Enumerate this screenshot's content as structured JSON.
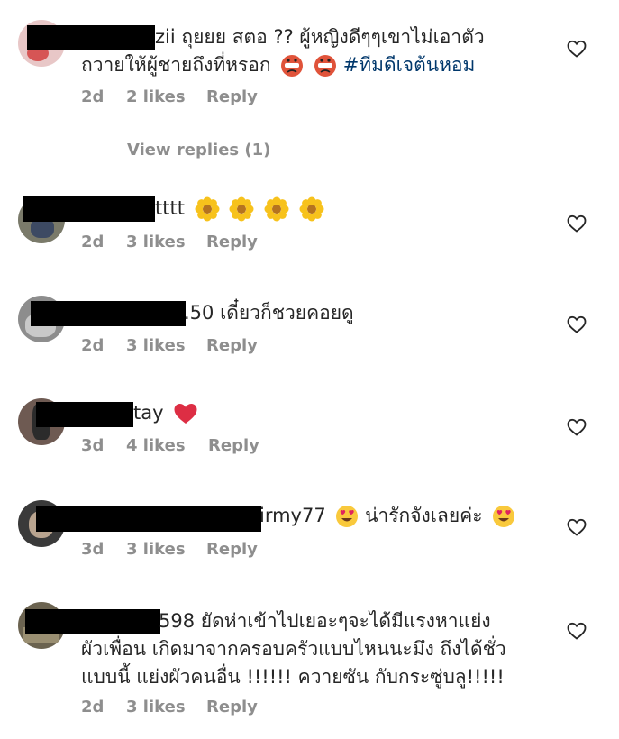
{
  "comments": [
    {
      "username_visible": "zii",
      "lines": [
        "ถุยยย สตอ ?? ผู้หญิงดีๆๆเขาไม่เอาตัว",
        "ถวายให้ผู้ชายถึงที่หรอก"
      ],
      "hashtag": "#ทีมดีเจต้นหอม",
      "emojis": [
        "angry-face-icon",
        "angry-face-icon"
      ],
      "age": "2d",
      "likes": "2 likes",
      "reply": "Reply",
      "avatar_color": "#e8c7c7"
    },
    {
      "username_visible": "tttt",
      "lines": [
        ""
      ],
      "emojis": [
        "sunflower-icon",
        "sunflower-icon",
        "sunflower-icon",
        "sunflower-icon"
      ],
      "age": "2d",
      "likes": "3 likes",
      "reply": "Reply",
      "avatar_color": "#7a7a6a"
    },
    {
      "username_visible": ".50",
      "lines": [
        "เดี๋ยวก็ชวยคอยดู"
      ],
      "age": "2d",
      "likes": "3 likes",
      "reply": "Reply",
      "avatar_color": "#8d8d8d"
    },
    {
      "username_visible": "tay",
      "lines": [
        ""
      ],
      "emojis": [
        "red-heart-icon"
      ],
      "age": "3d",
      "likes": "4 likes",
      "reply": "Reply",
      "avatar_color": "#6e5a52"
    },
    {
      "username_visible": "irmy77",
      "lines": [
        "น่ารักจังเลยค่ะ"
      ],
      "emojis": [
        "heart-eyes-face-icon",
        "heart-eyes-face-icon"
      ],
      "age": "3d",
      "likes": "3 likes",
      "reply": "Reply",
      "avatar_color": "#3a3a3a"
    },
    {
      "username_visible": "598",
      "lines": [
        "ยัดห่าเข้าไปเยอะๆจะได้มีแรงหาแย่ง",
        "ผัวเพื่อน เกิดมาจากครอบครัวแบบไหนนะมึง ถึงได้ชั่ว",
        "แบบนี้ แย่งผัวคนอื่น !!!!!! ควายซัน กับกระซู่บลู!!!!!"
      ],
      "age": "2d",
      "likes": "3 likes",
      "reply": "Reply",
      "avatar_color": "#6b6350"
    }
  ],
  "view_replies": "View replies (1)",
  "colors": {
    "meta": "#8e8e8e",
    "text": "#262626",
    "hashtag": "#00376b"
  }
}
